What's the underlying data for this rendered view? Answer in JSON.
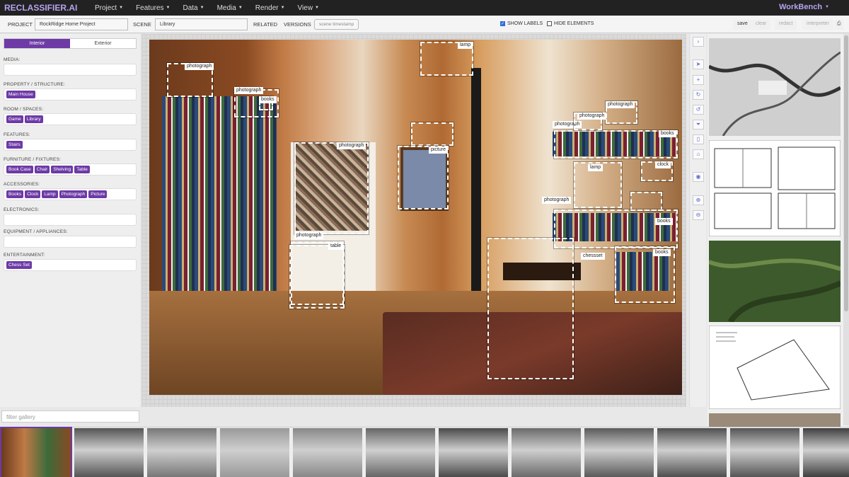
{
  "brand": "RECLASSIFIER.AI",
  "nav": {
    "menus": [
      "Project",
      "Features",
      "Data",
      "Media",
      "Render",
      "View"
    ],
    "workbench": "WorkBench",
    "workbench_icon": "caret-down-icon"
  },
  "toolbar": {
    "project_label": "PROJECT",
    "project_value": "RockRidge Home Project",
    "scene_label": "SCENE",
    "scene_value": "Library",
    "related_label": "RELATED",
    "versions_label": "VERSIONS",
    "timestamp_placeholder": "scene timestamp",
    "show_labels": "SHOW LABELS",
    "show_labels_checked": true,
    "hide_elements": "HIDE ELEMENTS",
    "hide_elements_checked": false,
    "save": "save",
    "clear": "clear",
    "redact": "redact",
    "interpreter": "interpreter"
  },
  "left": {
    "tabs": [
      "Interior",
      "Exterior"
    ],
    "active_tab": "Interior",
    "categories": [
      {
        "name": "MEDIA:",
        "tags": []
      },
      {
        "name": "PROPERTY / STRUCTURE:",
        "tags": [
          "Main House"
        ]
      },
      {
        "name": "ROOM / SPACES:",
        "tags": [
          "Game",
          "Library"
        ]
      },
      {
        "name": "FEATURES:",
        "tags": [
          "Stairs"
        ]
      },
      {
        "name": "FURNITURE / FIXTURES:",
        "tags": [
          "Book Case",
          "Chair",
          "Shelving",
          "Table"
        ]
      },
      {
        "name": "ACCESSORIES:",
        "tags": [
          "Books",
          "Clock",
          "Lamp",
          "Photograph",
          "Picture"
        ]
      },
      {
        "name": "ELECTRONICS:",
        "tags": []
      },
      {
        "name": "EQUIPMENT / APPLIANCES:",
        "tags": []
      },
      {
        "name": "ENTERTAINMENT:",
        "tags": [
          "Chess Set"
        ]
      }
    ],
    "filter_placeholder": "filter gallery"
  },
  "detections": [
    "photograph",
    "photograph",
    "books",
    "lamp",
    "photograph",
    "picture",
    "photograph",
    "photograph",
    "books",
    "lamp",
    "clock",
    "photograph",
    "photograph",
    "photograph",
    "table",
    "books",
    "chessset",
    "books"
  ],
  "tools": [
    "chevron-right-icon",
    "navigate-icon",
    "plus-box-icon",
    "rotate-cw-icon",
    "rotate-ccw-icon",
    "filter-icon",
    "page-icon",
    "bookmark-icon",
    "camera-icon",
    "zoom-in-icon",
    "zoom-out-icon"
  ],
  "colors": {
    "accent": "#6d3aa6",
    "brand": "#b9a3f0",
    "nav": "#222222"
  }
}
